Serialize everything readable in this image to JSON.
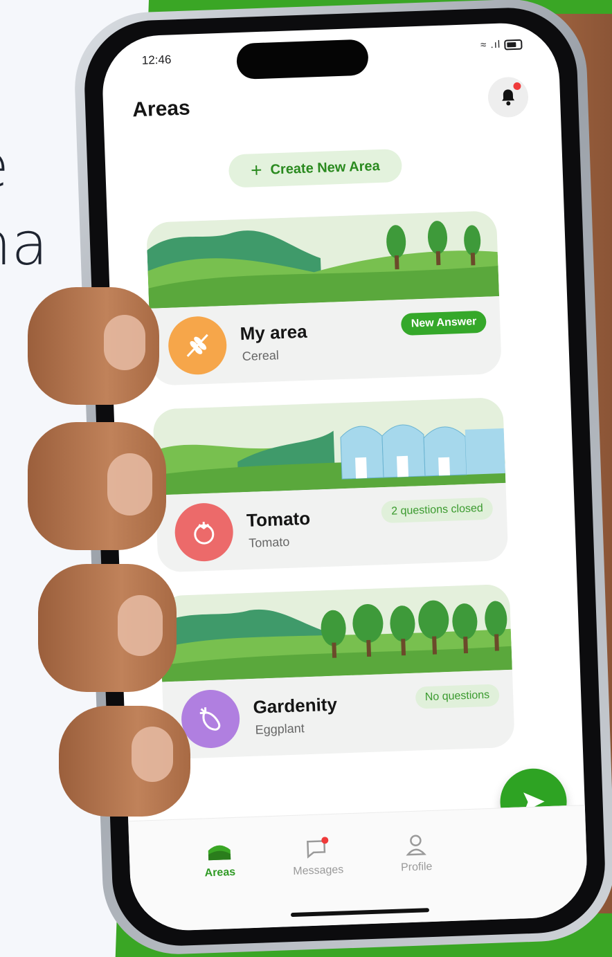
{
  "background": {
    "line1": "e",
    "line2": "na"
  },
  "status_bar": {
    "time": "12:46"
  },
  "header": {
    "title": "Areas"
  },
  "actions": {
    "create_label": "Create New Area",
    "create_icon": "plus-icon"
  },
  "areas": [
    {
      "name": "My area",
      "crop": "Cereal",
      "badge": "New Answer",
      "badge_style": "solid",
      "avatar_color": "#f6a64a",
      "icon": "wheat-icon",
      "scene": "hills-trees"
    },
    {
      "name": "Tomato",
      "crop": "Tomato",
      "badge": "2 questions closed",
      "badge_style": "soft",
      "avatar_color": "#ec6a6a",
      "icon": "tomato-icon",
      "scene": "greenhouse"
    },
    {
      "name": "Gardenity",
      "crop": "Eggplant",
      "badge": "No questions",
      "badge_style": "soft",
      "avatar_color": "#b07fe0",
      "icon": "eggplant-icon",
      "scene": "orchard"
    }
  ],
  "tabbar": {
    "areas": "Areas",
    "messages": "Messages",
    "profile": "Profile"
  },
  "colors": {
    "brand_green": "#2ea323",
    "background_green": "#3aa625",
    "notification_red": "#ef3a3a"
  }
}
